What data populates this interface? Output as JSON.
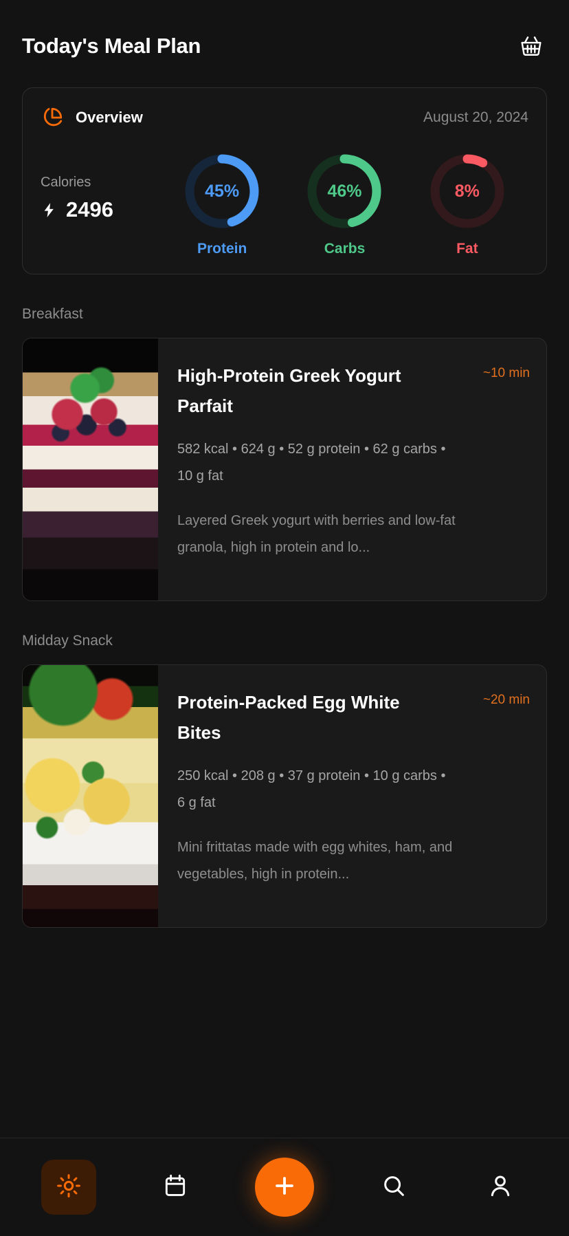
{
  "header": {
    "title": "Today's Meal Plan",
    "basket_icon": "shopping-basket-icon"
  },
  "overview": {
    "icon": "pie-chart-icon",
    "title": "Overview",
    "date": "August 20, 2024",
    "calories_label": "Calories",
    "calories_icon": "lightning-bolt-icon",
    "calories_value": "2496",
    "macros": [
      {
        "name": "Protein",
        "percent_label": "45%",
        "percent": 45,
        "color": "#4d9bf5",
        "track": "#16263a"
      },
      {
        "name": "Carbs",
        "percent_label": "46%",
        "percent": 46,
        "color": "#4ec98a",
        "track": "#16301f"
      },
      {
        "name": "Fat",
        "percent_label": "8%",
        "percent": 8,
        "color": "#fb5a62",
        "track": "#32191c"
      }
    ]
  },
  "sections": [
    {
      "label": "Breakfast",
      "meal": {
        "title": "High-Protein Greek Yogurt Parfait",
        "time": "~10 min",
        "macros": "582 kcal • 624 g • 52 g protein • 62 g carbs • 10 g fat",
        "description": "Layered Greek yogurt with berries and low-fat granola, high in protein and lo...",
        "image_alt": "greek-yogurt-parfait-photo"
      }
    },
    {
      "label": "Midday Snack",
      "meal": {
        "title": "Protein-Packed Egg White Bites",
        "time": "~20 min",
        "macros": "250 kcal • 208 g • 37 g protein • 10 g carbs • 6 g fat",
        "description": "Mini frittatas made with egg whites, ham, and vegetables, high in protein...",
        "image_alt": "egg-white-bites-photo"
      }
    }
  ],
  "bottom_nav": {
    "items": [
      {
        "icon": "sun-icon",
        "name": "today",
        "active": true
      },
      {
        "icon": "calendar-icon",
        "name": "calendar",
        "active": false
      },
      {
        "icon": "plus-icon",
        "name": "add",
        "active": false
      },
      {
        "icon": "search-icon",
        "name": "search",
        "active": false
      },
      {
        "icon": "person-icon",
        "name": "profile",
        "active": false
      }
    ]
  },
  "theme": {
    "accent": "#f96b07",
    "background": "#131313",
    "card": "#1a1a1a"
  }
}
